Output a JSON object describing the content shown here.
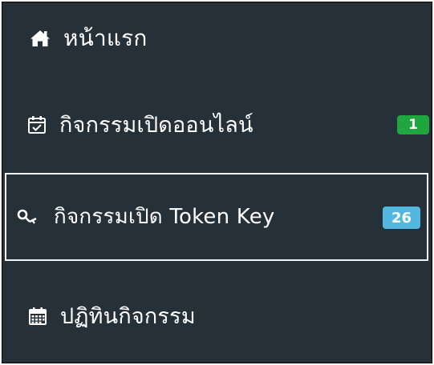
{
  "sidebar": {
    "items": [
      {
        "label": "หน้าแรก",
        "icon": "home-icon"
      },
      {
        "label": "กิจกรรมเปิดออนไลน์",
        "icon": "calendar-check-icon",
        "badge": "1",
        "badge_color": "#20a63f"
      },
      {
        "label": "กิจกรรมเปิด Token Key",
        "icon": "key-icon",
        "badge": "26",
        "badge_color": "#52b8e0",
        "active": true
      },
      {
        "label": "ปฏิทินกิจกรรม",
        "icon": "calendar-icon"
      }
    ]
  },
  "colors": {
    "sidebar_bg": "#263038",
    "active_border": "#f2f4f5",
    "text": "#ffffff"
  }
}
